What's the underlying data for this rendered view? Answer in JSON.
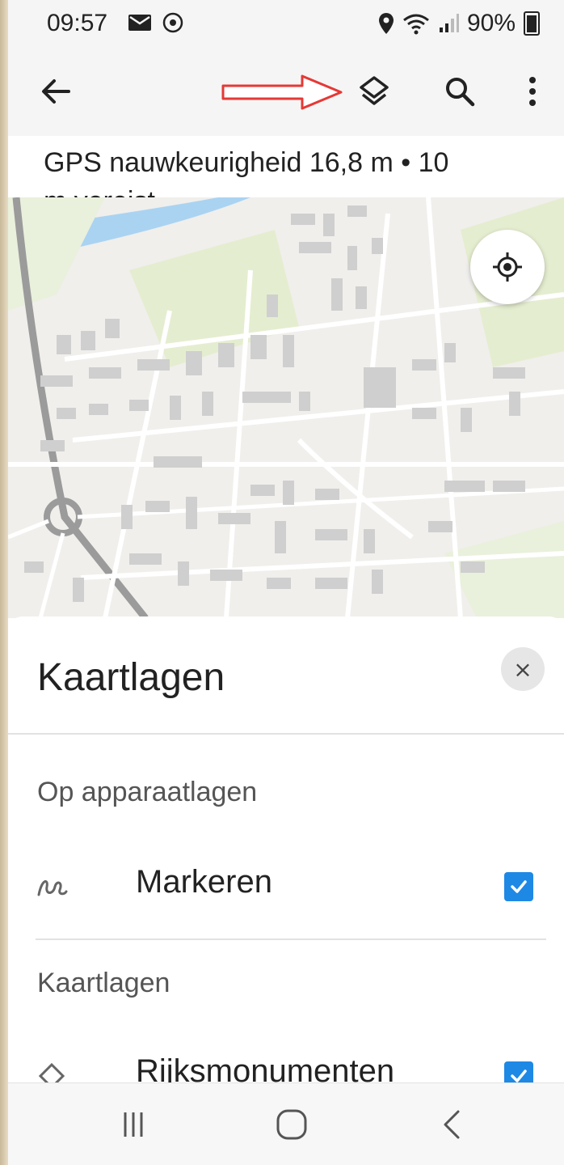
{
  "status": {
    "time": "09:57",
    "battery": "90%"
  },
  "toolbar": {
    "back_icon": "arrow-left-icon",
    "layers_icon": "layers-icon",
    "search_icon": "search-icon",
    "menu_icon": "more-vert-icon",
    "arrow_annotation_color": "#e53935"
  },
  "gps": {
    "line1": "GPS nauwkeurigheid 16,8 m  •  10",
    "line2": "m vereist"
  },
  "map": {
    "locate_icon": "my-location-icon"
  },
  "sheet": {
    "title": "Kaartlagen",
    "close_label": "×",
    "section1": "Op apparaatlagen",
    "row1": {
      "label": "Markeren",
      "icon": "squiggle-icon",
      "checked": true
    },
    "section2": "Kaartlagen",
    "row2": {
      "label": "Rijksmonumenten",
      "icon": "diamond-icon",
      "checked": true
    }
  },
  "colors": {
    "accent": "#1e88e5",
    "annotation": "#e53935"
  }
}
